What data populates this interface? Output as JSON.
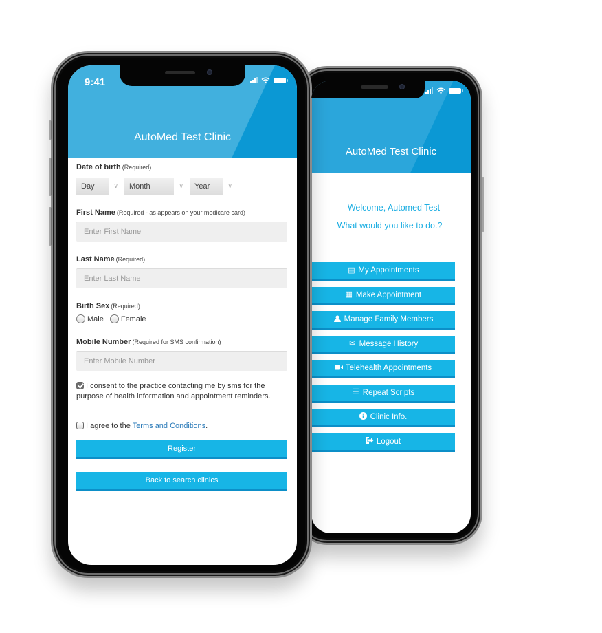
{
  "theme": {
    "accent": "#17b5e6",
    "header": "#41b0de",
    "link": "#2a7ab8",
    "welcome_text": "#1daee2"
  },
  "front_phone": {
    "status_time": "9:41",
    "clinic_title": "AutoMed Test Clinic",
    "form": {
      "dob": {
        "label": "Date of birth",
        "hint": "(Required)",
        "day": "Day",
        "month": "Month",
        "year": "Year"
      },
      "first_name": {
        "label": "First Name",
        "hint": "(Required - as appears on your medicare card)",
        "placeholder": "Enter First Name"
      },
      "last_name": {
        "label": "Last Name",
        "hint": "(Required)",
        "placeholder": "Enter Last Name"
      },
      "birth_sex": {
        "label": "Birth Sex",
        "hint": "(Required)",
        "options": [
          "Male",
          "Female"
        ]
      },
      "mobile": {
        "label": "Mobile Number",
        "hint": "(Required for SMS confirmation)",
        "placeholder": "Enter Mobile Number"
      },
      "consent": {
        "checked": true,
        "text": "I consent to the practice contacting me by sms for the purpose of health information and appointment reminders."
      },
      "terms": {
        "checked": false,
        "prefix": "I agree to the ",
        "link": "Terms and Conditions",
        "suffix": "."
      },
      "register_label": "Register",
      "back_label": "Back to search clinics"
    }
  },
  "back_phone": {
    "clinic_title": "AutoMed Test Clinic",
    "welcome": "Welcome, Automed Test",
    "prompt": "What would you like to do.?",
    "menu": [
      {
        "label": "My Appointments",
        "icon": "list-icon",
        "glyph": "▤"
      },
      {
        "label": "Make Appointment",
        "icon": "calendar-icon",
        "glyph": "▦"
      },
      {
        "label": "Manage Family Members",
        "icon": "user-icon",
        "glyph": "👤"
      },
      {
        "label": "Message History",
        "icon": "envelope-icon",
        "glyph": "✉"
      },
      {
        "label": "Telehealth Appointments",
        "icon": "video-camera-icon",
        "glyph": "■"
      },
      {
        "label": "Repeat Scripts",
        "icon": "tasks-icon",
        "glyph": "☰"
      },
      {
        "label": "Clinic Info.",
        "icon": "info-icon",
        "glyph": "ℹ"
      },
      {
        "label": "Logout",
        "icon": "logout-icon",
        "glyph": "⇨"
      }
    ]
  }
}
